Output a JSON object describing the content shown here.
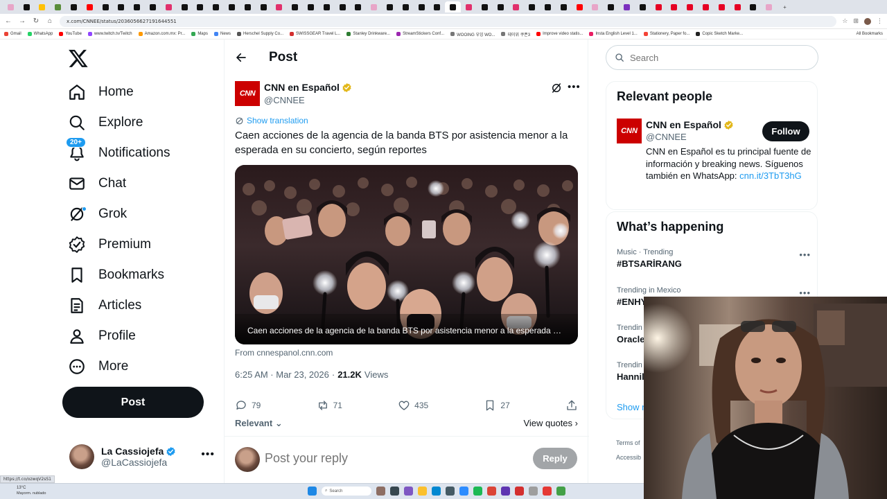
{
  "browser": {
    "url": "x.com/CNNEE/status/2036056627191644551",
    "tab_favicon_colors": [
      "#e8a5c8",
      "#111111",
      "#ffc107",
      "#5a8d3b",
      "#111111",
      "#ff0000",
      "#111111",
      "#111111",
      "#111111",
      "#111111",
      "#e1306c",
      "#111111",
      "#111111",
      "#111111",
      "#111111",
      "#111111",
      "#111111",
      "#e1306c",
      "#111111",
      "#111111",
      "#111111",
      "#111111",
      "#111111",
      "#e8a5c8",
      "#111111",
      "#111111",
      "#111111",
      "#111111",
      "#111111",
      "#e1306c",
      "#111111",
      "#111111",
      "#e1306c",
      "#111111",
      "#111111",
      "#111111",
      "#ff0000",
      "#e8a5c8",
      "#111111",
      "#7b2fbe",
      "#111111",
      "#e60023",
      "#e60023",
      "#e60023",
      "#e60023",
      "#e60023",
      "#e60023",
      "#111111",
      "#e8a5c8"
    ],
    "new_tab": "+",
    "bookmarks": [
      {
        "label": "Gmail",
        "color": "#ea4335"
      },
      {
        "label": "WhatsApp",
        "color": "#25d366"
      },
      {
        "label": "YouTube",
        "color": "#ff0000"
      },
      {
        "label": "www.twitch.tv/Twitch",
        "color": "#9146ff"
      },
      {
        "label": "Amazon.com.mx: Pr...",
        "color": "#ff9900"
      },
      {
        "label": "Maps",
        "color": "#34a853"
      },
      {
        "label": "News",
        "color": "#4285f4"
      },
      {
        "label": "Herschel Supply Co...",
        "color": "#555555"
      },
      {
        "label": "SWISSGEAR Travel L...",
        "color": "#d32f2f"
      },
      {
        "label": "Stanley Drinkware...",
        "color": "#2e7d32"
      },
      {
        "label": "StreamStickers Conf...",
        "color": "#9c27b0"
      },
      {
        "label": "WOOING 우잉 WO...",
        "color": "#777777"
      },
      {
        "label": "데이위 쿠폰3",
        "color": "#777777"
      },
      {
        "label": "Improve video statis...",
        "color": "#ff0000"
      },
      {
        "label": "Insta English Level 1...",
        "color": "#e91e63"
      },
      {
        "label": "Stationery, Paper fo...",
        "color": "#f44336"
      },
      {
        "label": "Copic Sketch Marke...",
        "color": "#212121"
      }
    ],
    "all_bookmarks": "All Bookmarks"
  },
  "nav": {
    "items": [
      {
        "label": "Home",
        "icon": "home-icon"
      },
      {
        "label": "Explore",
        "icon": "search-icon"
      },
      {
        "label": "Notifications",
        "icon": "bell-icon",
        "badge": "20+"
      },
      {
        "label": "Chat",
        "icon": "mail-icon"
      },
      {
        "label": "Grok",
        "icon": "grok-icon"
      },
      {
        "label": "Premium",
        "icon": "verified-badge-icon"
      },
      {
        "label": "Bookmarks",
        "icon": "bookmark-icon"
      },
      {
        "label": "Articles",
        "icon": "article-icon"
      },
      {
        "label": "Profile",
        "icon": "person-icon"
      },
      {
        "label": "More",
        "icon": "more-circle-icon"
      }
    ],
    "post_button": "Post",
    "account": {
      "name": "La Cassiojefa",
      "handle": "@LaCassiojefa"
    }
  },
  "post": {
    "header": "Post",
    "author": {
      "name": "CNN en Español",
      "handle": "@CNNEE",
      "logo_text": "CNN"
    },
    "show_translation": "Show translation",
    "text": "Caen acciones de la agencia de la banda BTS por asistencia menor a la esperada en su concierto, según reportes",
    "media_caption": "Caen acciones de la agencia de la banda BTS por asistencia menor a la esperada en su...",
    "source": "From cnnespanol.cnn.com",
    "timestamp": "6:25 AM · Mar 23, 2026",
    "views_count": "21.2K",
    "views_label": "Views",
    "stats": {
      "replies": "79",
      "reposts": "71",
      "likes": "435",
      "bookmarks": "27"
    },
    "sort_label": "Relevant",
    "view_quotes": "View quotes",
    "reply_placeholder": "Post your reply",
    "reply_button": "Reply"
  },
  "sidebar": {
    "search_placeholder": "Search",
    "relevant_people_title": "Relevant people",
    "person": {
      "name": "CNN en Español",
      "handle": "@CNNEE",
      "logo_text": "CNN",
      "follow_label": "Follow",
      "bio": "CNN en Español es tu principal fuente de información y breaking news. Síguenos también en WhatsApp: ",
      "bio_link": "cnn.it/3TbT3hG"
    },
    "happening_title": "What’s happening",
    "trends": [
      {
        "category": "Music · Trending",
        "name": "#BTSARİRANG"
      },
      {
        "category": "Trending in Mexico",
        "name": "#ENHY"
      },
      {
        "category": "Trendin",
        "name": "Oracle"
      },
      {
        "category": "Trendin",
        "name": "Hannil"
      }
    ],
    "show_more": "Show m",
    "footer": [
      "Terms of",
      "Accessib"
    ]
  },
  "status_url": "https://t.co/ozwqV2sS1",
  "taskbar": {
    "temp": "13°C",
    "weather": "Mayorm. nublado",
    "search": "Search"
  }
}
